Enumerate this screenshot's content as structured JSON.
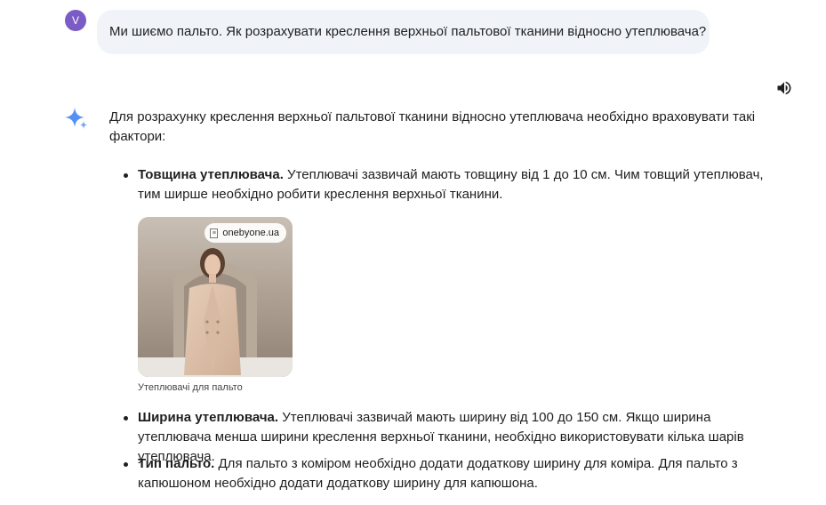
{
  "user": {
    "avatar_letter": "V",
    "message": "Ми шиємо пальто. Як розрахувати креслення верхньої пальтової тканини відносно утеплювача?"
  },
  "response": {
    "intro": "Для розрахунку креслення верхньої пальтової тканини відносно утеплювача необхідно враховувати такі фактори:",
    "bullets": [
      {
        "title": "Товщина утеплювача.",
        "text": " Утеплювачі зазвичай мають товщину від 1 до 10 см. Чим товщий утеплювач, тим ширше необхідно робити креслення верхньої тканини."
      },
      {
        "title": "Ширина утеплювача.",
        "text": " Утеплювачі зазвичай мають ширину від 100 до 150 см. Якщо ширина утеплювача менша ширини креслення верхньої тканини, необхідно використовувати кілька шарів утеплювача."
      },
      {
        "title": "Тип пальто.",
        "text": " Для пальто з коміром необхідно додати додаткову ширину для коміра. Для пальто з капюшоном необхідно додати додаткову ширину для капюшона."
      }
    ],
    "image": {
      "source": "onebyone.ua",
      "caption": "Утеплювачі для пальто"
    }
  },
  "icons": {
    "speaker": "speaker-icon",
    "sparkle": "sparkle-icon"
  },
  "colors": {
    "avatar": "#7b5cc6",
    "bubble": "#f0f4f9",
    "sparkle": "#4285f4"
  }
}
